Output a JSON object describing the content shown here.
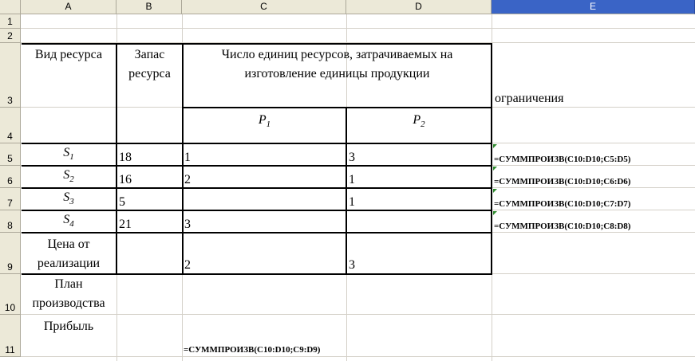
{
  "columns": [
    "A",
    "B",
    "C",
    "D",
    "E"
  ],
  "rows": [
    "1",
    "2",
    "3",
    "4",
    "5",
    "6",
    "7",
    "8",
    "9",
    "10",
    "11"
  ],
  "header": {
    "resource_type": "Вид ресурса",
    "stock_line1": "Запас",
    "stock_line2": "ресурса",
    "units_line1": "Число единиц ресурсов, затрачиваемых на",
    "units_line2": "изготовление единицы продукции",
    "constraints": "ограничения",
    "p1": "P",
    "p1_sub": "1",
    "p2": "P",
    "p2_sub": "2"
  },
  "resources": [
    {
      "name": "S",
      "sub": "1",
      "stock": "18",
      "c": "1",
      "d": "3",
      "formula": "=СУММПРОИЗВ(C10:D10;C5:D5)"
    },
    {
      "name": "S",
      "sub": "2",
      "stock": "16",
      "c": "2",
      "d": "1",
      "formula": "=СУММПРОИЗВ(C10:D10;C6:D6)"
    },
    {
      "name": "S",
      "sub": "3",
      "stock": "5",
      "c": "",
      "d": "1",
      "formula": "=СУММПРОИЗВ(C10:D10;C7:D7)"
    },
    {
      "name": "S",
      "sub": "4",
      "stock": "21",
      "c": "3",
      "d": "",
      "formula": "=СУММПРОИЗВ(C10:D10;C8:D8)"
    }
  ],
  "price": {
    "label_line1": "Цена от",
    "label_line2": "реализации",
    "c": "2",
    "d": "3"
  },
  "plan": {
    "label_line1": "План",
    "label_line2": "производства"
  },
  "profit": {
    "label": "Прибыль",
    "formula": "=СУММПРОИЗВ(C10:D10;C9:D9)"
  }
}
